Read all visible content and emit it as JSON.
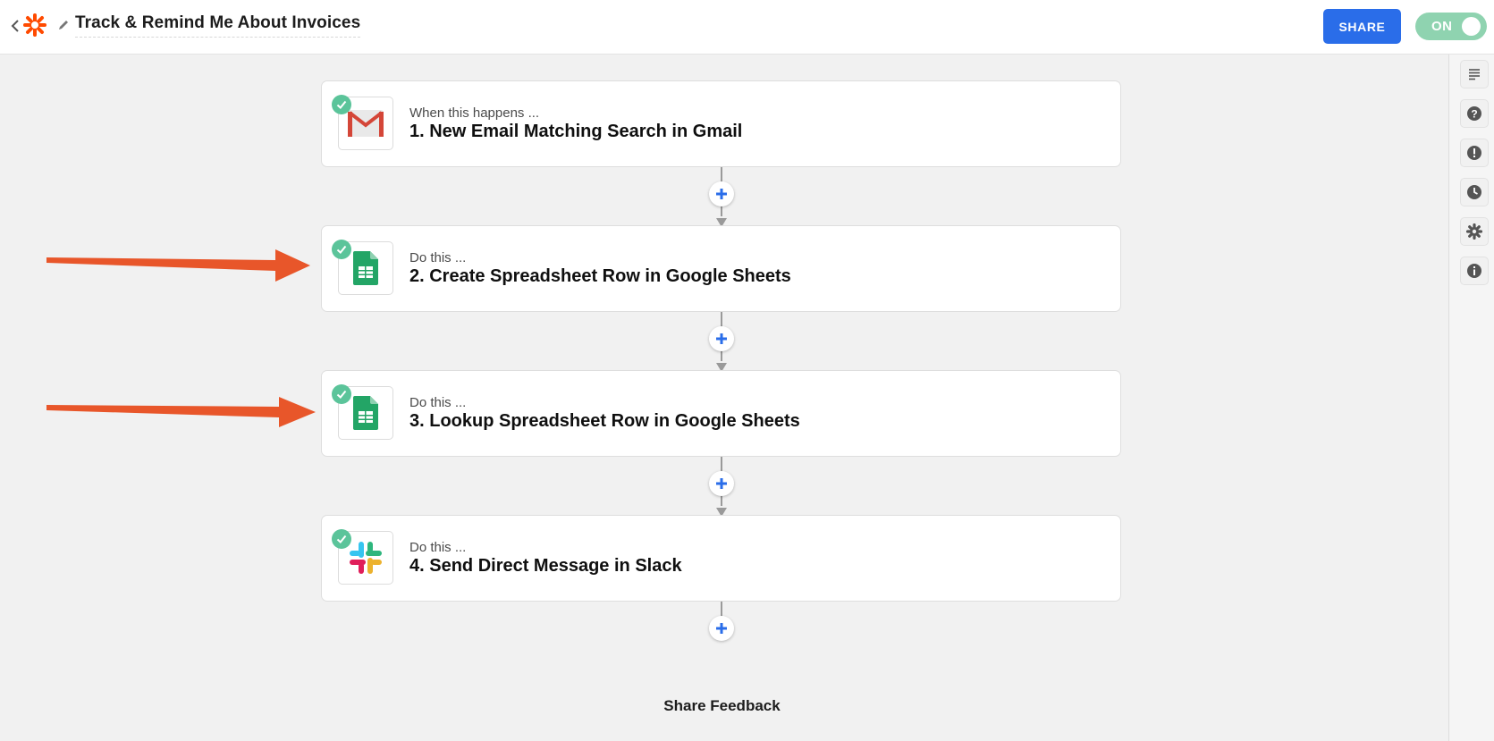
{
  "header": {
    "title": "Track & Remind Me About Invoices",
    "share_label": "SHARE",
    "toggle_label": "ON"
  },
  "steps": [
    {
      "prefix": "When this happens ...",
      "title": "1. New Email Matching Search in Gmail",
      "app_icon": "gmail-icon"
    },
    {
      "prefix": "Do this ...",
      "title": "2. Create Spreadsheet Row in Google Sheets",
      "app_icon": "google-sheets-icon"
    },
    {
      "prefix": "Do this ...",
      "title": "3. Lookup Spreadsheet Row in Google Sheets",
      "app_icon": "google-sheets-icon"
    },
    {
      "prefix": "Do this ...",
      "title": "4. Send Direct Message in Slack",
      "app_icon": "slack-icon"
    }
  ],
  "sidebar": {
    "icons": [
      "notes-icon",
      "help-icon",
      "alert-icon",
      "history-icon",
      "settings-icon",
      "info-icon"
    ]
  },
  "footer": {
    "feedback_label": "Share Feedback"
  },
  "colors": {
    "accent": "#2a6de9",
    "toggle_on": "#8fd3b0",
    "check": "#5bc49a",
    "annotation_arrow": "#e8562a",
    "brand": "#ff4a00"
  }
}
